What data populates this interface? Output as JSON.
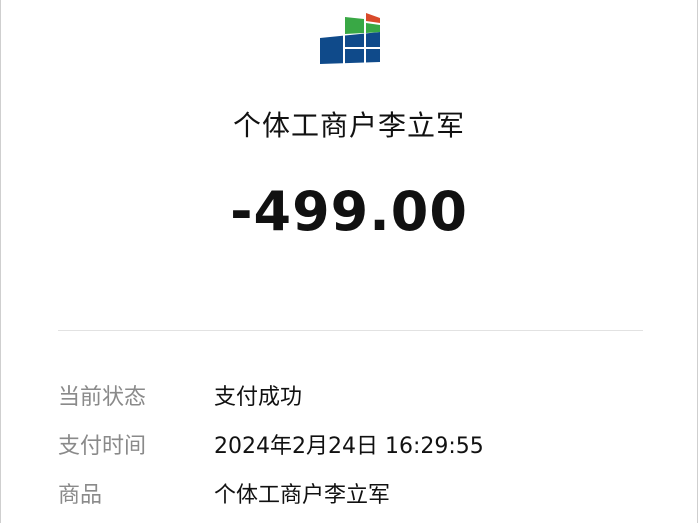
{
  "logo": {
    "icon": "bank-logo-icon",
    "colors": {
      "blue": "#0f4a8a",
      "green": "#39a845",
      "red": "#d94a2b"
    }
  },
  "merchant_name": "个体工商户李立军",
  "amount": "-499.00",
  "details": [
    {
      "label": "当前状态",
      "value": "支付成功"
    },
    {
      "label": "支付时间",
      "value": "2024年2月24日 16:29:55"
    },
    {
      "label": "商品",
      "value": "个体工商户李立军"
    }
  ]
}
